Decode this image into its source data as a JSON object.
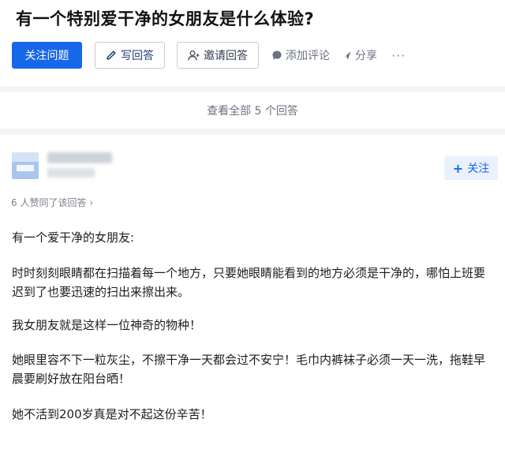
{
  "question": {
    "title": "有一个特别爱干净的女朋友是什么体验?",
    "follow_label": "关注问题",
    "answer_label": "写回答",
    "invite_label": "邀请回答",
    "comment_label": "添加评论",
    "share_label": "分享",
    "more_label": "···"
  },
  "view_all": {
    "label": "查看全部 5 个回答"
  },
  "answer": {
    "follow_label": "关注",
    "upvote_text": "6 人赞同了该回答 ›",
    "paragraphs": [
      "有一个爱干净的女朋友:",
      "时时刻刻眼睛都在扫描着每一个地方，只要她眼睛能看到的地方必须是干净的，哪怕上班要迟到了也要迅速的扫出来擦出来。",
      "我女朋友就是这样一位神奇的物种！",
      "她眼里容不下一粒灰尘，不擦干净一天都会过不安宁！毛巾内裤袜子必须一天一洗，拖鞋早晨要刷好放在阳台晒！",
      "她不活到200岁真是对不起这份辛苦！"
    ]
  },
  "icons": {
    "answer": "pen-icon",
    "invite": "person-plus-icon",
    "comment": "comment-bubble-icon",
    "share": "share-arrow-icon"
  },
  "colors": {
    "primary": "#1767ea",
    "page_bg": "#f3f5f8",
    "follow_bg": "#eaf1fd"
  }
}
